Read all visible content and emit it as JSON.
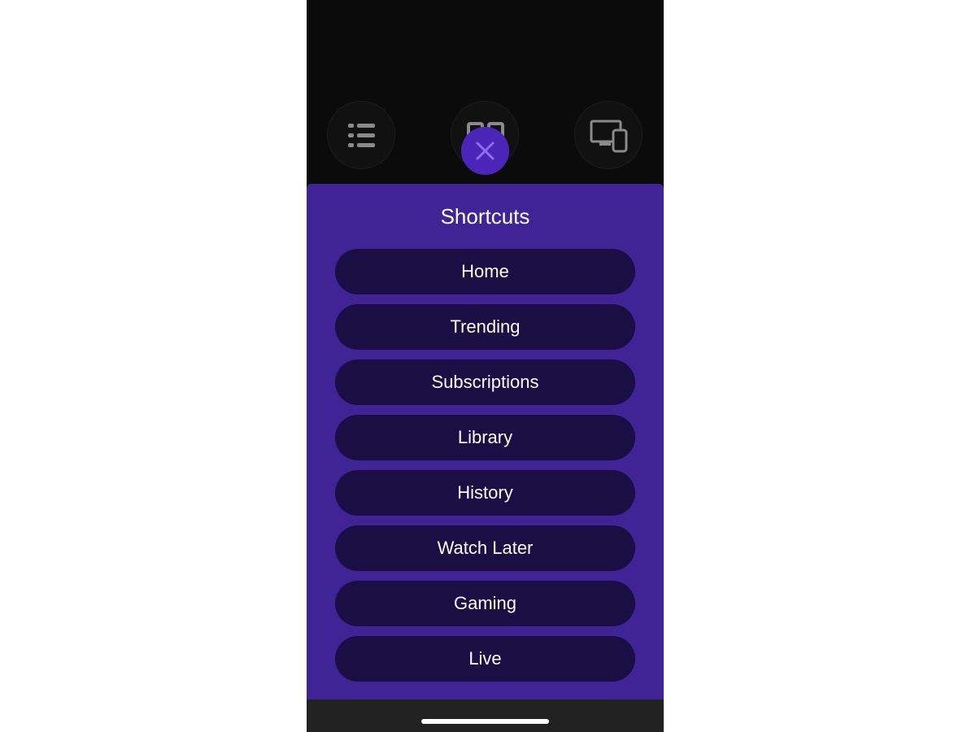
{
  "shortcuts": {
    "title": "Shortcuts",
    "items": [
      {
        "label": "Home"
      },
      {
        "label": "Trending"
      },
      {
        "label": "Subscriptions"
      },
      {
        "label": "Library"
      },
      {
        "label": "History"
      },
      {
        "label": "Watch Later"
      },
      {
        "label": "Gaming"
      },
      {
        "label": "Live"
      }
    ]
  },
  "top_icons": [
    {
      "icon": "list-icon"
    },
    {
      "icon": "grid-icon"
    },
    {
      "icon": "devices-icon"
    }
  ],
  "close_icon": "close-icon",
  "colors": {
    "sheet_background": "#402496",
    "button_background": "#1a0e44",
    "accent": "#4a26b8",
    "close_glyph": "#8f6cf0",
    "screen_background": "#0b0b0b"
  }
}
